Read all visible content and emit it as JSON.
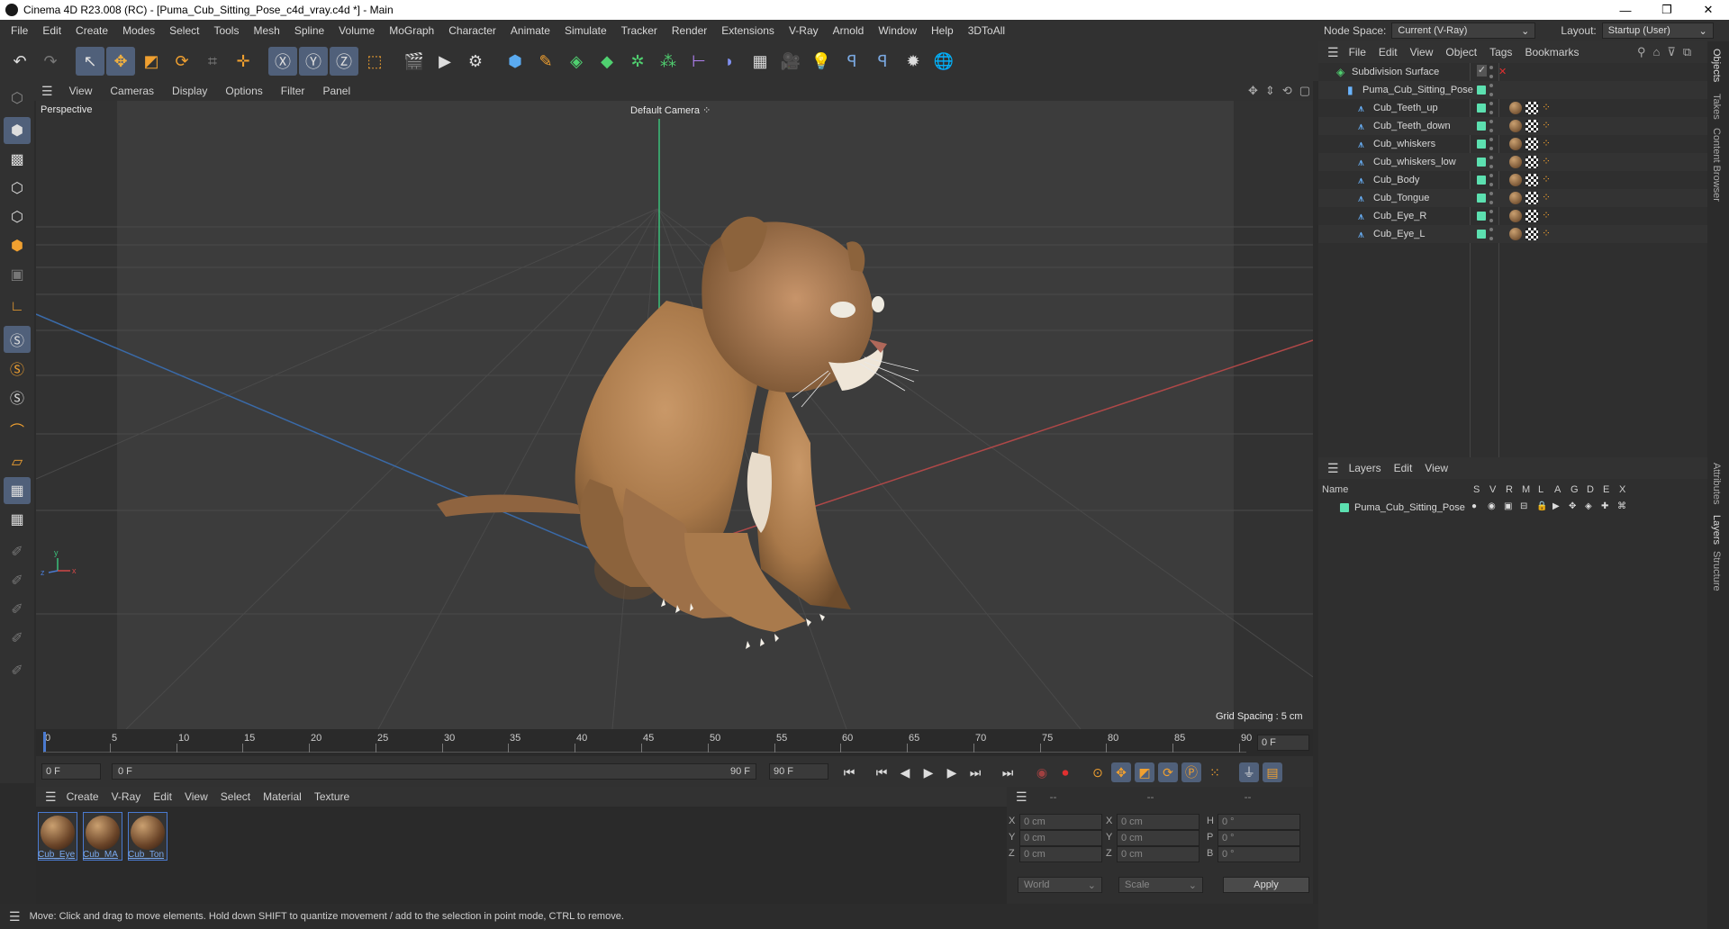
{
  "window": {
    "title": "Cinema 4D R23.008 (RC) - [Puma_Cub_Sitting_Pose_c4d_vray.c4d *] - Main",
    "minimize": "—",
    "maximize": "❐",
    "close": "✕"
  },
  "menu": [
    "File",
    "Edit",
    "Create",
    "Modes",
    "Select",
    "Tools",
    "Mesh",
    "Spline",
    "Volume",
    "MoGraph",
    "Character",
    "Animate",
    "Simulate",
    "Tracker",
    "Render",
    "Extensions",
    "V-Ray",
    "Arnold",
    "Window",
    "Help",
    "3DToAll"
  ],
  "nodespace": {
    "label": "Node Space:",
    "value": "Current (V-Ray)",
    "layout_label": "Layout:",
    "layout_value": "Startup (User)"
  },
  "viewport": {
    "menu": [
      "View",
      "Cameras",
      "Display",
      "Options",
      "Filter",
      "Panel"
    ],
    "name": "Perspective",
    "camera": "Default Camera",
    "grid_spacing": "Grid Spacing : 5 cm"
  },
  "timeline": {
    "ticks": [
      "0",
      "5",
      "10",
      "15",
      "20",
      "25",
      "30",
      "35",
      "40",
      "45",
      "50",
      "55",
      "60",
      "65",
      "70",
      "75",
      "80",
      "85",
      "90"
    ],
    "current_frame": "0 F",
    "start_field": "0 F",
    "range_start": "0 F",
    "range_end": "90 F",
    "end_field": "90 F"
  },
  "materials": {
    "menu": [
      "Create",
      "V-Ray",
      "Edit",
      "View",
      "Select",
      "Material",
      "Texture"
    ],
    "items": [
      "Cub_Eye",
      "Cub_MA",
      "Cub_Ton"
    ]
  },
  "coords": {
    "header": [
      "--",
      "--",
      "--"
    ],
    "rows": [
      {
        "a": "X",
        "av": "0 cm",
        "b": "X",
        "bv": "0 cm",
        "c": "H",
        "cv": "0 °"
      },
      {
        "a": "Y",
        "av": "0 cm",
        "b": "Y",
        "bv": "0 cm",
        "c": "P",
        "cv": "0 °"
      },
      {
        "a": "Z",
        "av": "0 cm",
        "b": "Z",
        "bv": "0 cm",
        "c": "B",
        "cv": "0 °"
      }
    ],
    "mode": "World",
    "scale": "Scale",
    "apply": "Apply"
  },
  "status": "Move: Click and drag to move elements. Hold down SHIFT to quantize movement / add to the selection in point mode, CTRL to remove.",
  "objects": {
    "menu": [
      "File",
      "Edit",
      "View",
      "Object",
      "Tags",
      "Bookmarks"
    ],
    "items": [
      {
        "name": "Subdivision Surface",
        "level": 0
      },
      {
        "name": "Puma_Cub_Sitting_Pose",
        "level": 1
      },
      {
        "name": "Cub_Teeth_up",
        "level": 2
      },
      {
        "name": "Cub_Teeth_down",
        "level": 2
      },
      {
        "name": "Cub_whiskers",
        "level": 2
      },
      {
        "name": "Cub_whiskers_low",
        "level": 2
      },
      {
        "name": "Cub_Body",
        "level": 2
      },
      {
        "name": "Cub_Tongue",
        "level": 2
      },
      {
        "name": "Cub_Eye_R",
        "level": 2
      },
      {
        "name": "Cub_Eye_L",
        "level": 2
      }
    ]
  },
  "layers": {
    "menu": [
      "Layers",
      "Edit",
      "View"
    ],
    "columns": [
      "Name",
      "S",
      "V",
      "R",
      "M",
      "L",
      "A",
      "G",
      "D",
      "E",
      "X"
    ],
    "items": [
      "Puma_Cub_Sitting_Pose"
    ]
  },
  "side_tabs": [
    "Objects",
    "Takes",
    "Content Browser",
    "Attributes",
    "Layers",
    "Structure"
  ],
  "colors": {
    "accent": "#50607a",
    "chip": "#5ce0b0",
    "fur": "#b88652"
  }
}
